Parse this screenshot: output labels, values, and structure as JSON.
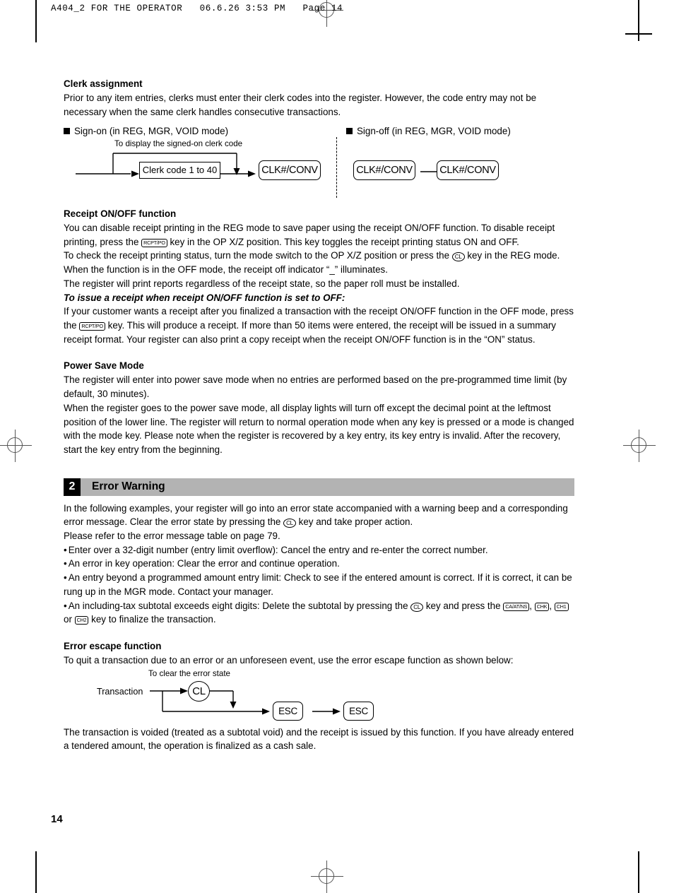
{
  "running_head": "A404_2 FOR THE OPERATOR   06.6.26 3:53 PM   Page 14",
  "folio": "14",
  "clerk": {
    "heading": "Clerk assignment",
    "paragraph": "Prior to any item entries, clerks must enter their clerk codes into the register.  However, the code entry may not be necessary when the same clerk handles consecutive transactions.",
    "signon_head": "Sign-on (in REG, MGR, VOID mode)",
    "signoff_head": "Sign-off (in REG, MGR, VOID mode)",
    "signon_note": "To display the signed-on clerk code",
    "clerk_code_box": "Clerk code 1 to 40",
    "clk_key": "CLK#/CONV",
    "signoff_key_1": "CLK#/CONV",
    "signoff_key_2": "CLK#/CONV"
  },
  "receipt": {
    "heading": "Receipt ON/OFF function",
    "p1_a": "You can disable receipt printing in the REG mode to save paper using the receipt ON/OFF function. To disable receipt printing, press the ",
    "p1_key": "RCPT/PO",
    "p1_b": " key in the OP X/Z position.  This key toggles the receipt printing status ON and OFF.",
    "p2_a": "To check the receipt printing status, turn the mode switch to the OP X/Z position or press the ",
    "p2_key": "CL",
    "p2_b": " key in the REG mode. When the function is in the OFF mode, the receipt off indicator “_” illuminates.",
    "p3": "The register will print reports regardless of the receipt state, so the paper roll must be installed.",
    "p4_bold": "To issue a receipt when receipt ON/OFF function is set to OFF:",
    "p5_a": "If your customer wants a receipt after you finalized a transaction with the receipt ON/OFF function in the OFF mode, press the ",
    "p5_key": "RCPT/PO",
    "p5_b": " key.  This will produce a receipt.  If more than 50 items were entered, the receipt will be issued in a summary receipt format.  Your register can also print a copy receipt when the receipt ON/OFF function is in the “ON” status."
  },
  "power_save": {
    "heading": "Power Save Mode",
    "p1": "The register will enter into power save mode when no entries are performed based on the pre-programmed time limit (by default, 30 minutes).",
    "p2": "When the register goes to the power save mode, all display lights will turn off except the decimal point at the leftmost position of the lower line.  The register will return to normal operation mode when any key is pressed or a mode is changed with the mode key.  Please note when the register is recovered by a key entry, its key entry is invalid.  After the recovery, start the key entry from the beginning."
  },
  "error_warning": {
    "number": "2",
    "title": "Error Warning",
    "p1_a": "In the following examples, your register will go into an error state accompanied with a warning beep and a corresponding error message.  Clear the error state by pressing the ",
    "p1_key": "CL",
    "p1_b": " key and take proper action.",
    "p2": "Please refer to the error message table on page 79.",
    "bullets": [
      "Enter over a 32-digit number (entry limit overflow): Cancel the entry and re-enter the correct number.",
      "An error in key operation: Clear the error and continue operation.",
      "An entry beyond a programmed amount entry limit: Check to see if the entered amount is correct.  If it is correct, it can be rung up in the MGR mode.  Contact your manager."
    ],
    "bullet4_a": "An including-tax subtotal exceeds eight digits: Delete the subtotal by pressing the ",
    "bullet4_key1": "CL",
    "bullet4_b": " key and press the ",
    "bullet4_key2": "CA/AT/NS",
    "bullet4_c": ", ",
    "bullet4_key3": "CHK",
    "bullet4_d": ", ",
    "bullet4_key4": "CH1",
    "bullet4_e": " or ",
    "bullet4_key5": "CH2",
    "bullet4_f": " key to finalize the transaction."
  },
  "error_escape": {
    "heading": "Error escape function",
    "intro": "To quit a transaction due to an error or an unforeseen event, use the error escape function as shown below:",
    "note": "To clear the error state",
    "transaction_label": "Transaction",
    "cl_key": "CL",
    "esc_key_1": "ESC",
    "esc_key_2": "ESC",
    "closing": "The transaction is voided (treated as a subtotal void) and the receipt is issued by this function.  If you have already entered a tendered amount, the operation is finalized as a cash sale."
  }
}
